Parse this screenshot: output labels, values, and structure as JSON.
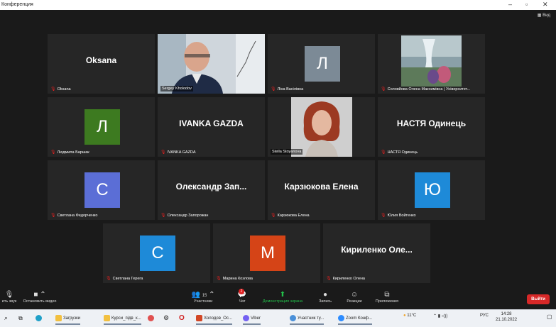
{
  "window": {
    "title": "Конференция",
    "view_label": "Вид"
  },
  "colors": {
    "tile_bg": "#262626",
    "active_border": "#a9d63a",
    "leave": "#d72828",
    "mic_muted": "#e02020"
  },
  "tiles": [
    {
      "kind": "text",
      "big": "Oksana",
      "label": "Oksana"
    },
    {
      "kind": "video",
      "label": "Sergey Kholodov",
      "active": true
    },
    {
      "kind": "letter",
      "letter": "Л",
      "color": "#7c8a96",
      "label": "Лiна Васiлiвна"
    },
    {
      "kind": "photo",
      "label": "Соловйова Олена Максимiвна | Унiверситет..."
    },
    {
      "kind": "letter",
      "letter": "Л",
      "color": "#3d7a20",
      "label": "Людмила Баршак"
    },
    {
      "kind": "text",
      "big": "IVANKA GAZDA",
      "label": "IVANKA GAZDA"
    },
    {
      "kind": "video2",
      "label": "Stella Stoyanova"
    },
    {
      "kind": "text",
      "big": "НАСТЯ Одинець",
      "label": "НАСТЯ Одинець"
    },
    {
      "kind": "letter",
      "letter": "С",
      "color": "#5b6ed6",
      "label": "Светлана Федорченко"
    },
    {
      "kind": "text",
      "big": "Олександр  Зап...",
      "label": "Олександр Запорожан"
    },
    {
      "kind": "text",
      "big": "Карзюкова Елена",
      "label": "Карзюкова Елена"
    },
    {
      "kind": "letter",
      "letter": "Ю",
      "color": "#1e8ad8",
      "label": "Юлия Войтенко"
    },
    {
      "kind": "letter",
      "letter": "С",
      "color": "#1e8ad8",
      "label": "Светлана Герега"
    },
    {
      "kind": "letter",
      "letter": "М",
      "color": "#d54417",
      "label": "Марина Козлова"
    },
    {
      "kind": "text",
      "big": "Кириленко  Оле...",
      "label": "Кириленко Олена"
    }
  ],
  "toolbar": {
    "audio_label": "ить звук",
    "video_label": "Остановить видео",
    "participants_label": "Участники",
    "participants_count": "15",
    "chat_label": "Чат",
    "chat_badge": "2",
    "share_label": "Демонстрация экрана",
    "record_label": "Запись",
    "reactions_label": "Реакции",
    "apps_label": "Приложения",
    "leave_label": "Выйти"
  },
  "taskbar": {
    "items": [
      {
        "label": "Загрузки",
        "color": "#f2c040"
      },
      {
        "label": "Курси_підв_к...",
        "color": "#f2c040"
      },
      {
        "label": "Холодов_Ос...",
        "color": "#d24726"
      },
      {
        "label": "Viber",
        "color": "#7360f2"
      },
      {
        "label": "Участник ту...",
        "color": "#4a90d9"
      },
      {
        "label": "Zoom Конф...",
        "color": "#2d8cff"
      }
    ],
    "weather": "11°C",
    "lang": "РУС",
    "time": "14:28",
    "date": "21.10.2022"
  }
}
